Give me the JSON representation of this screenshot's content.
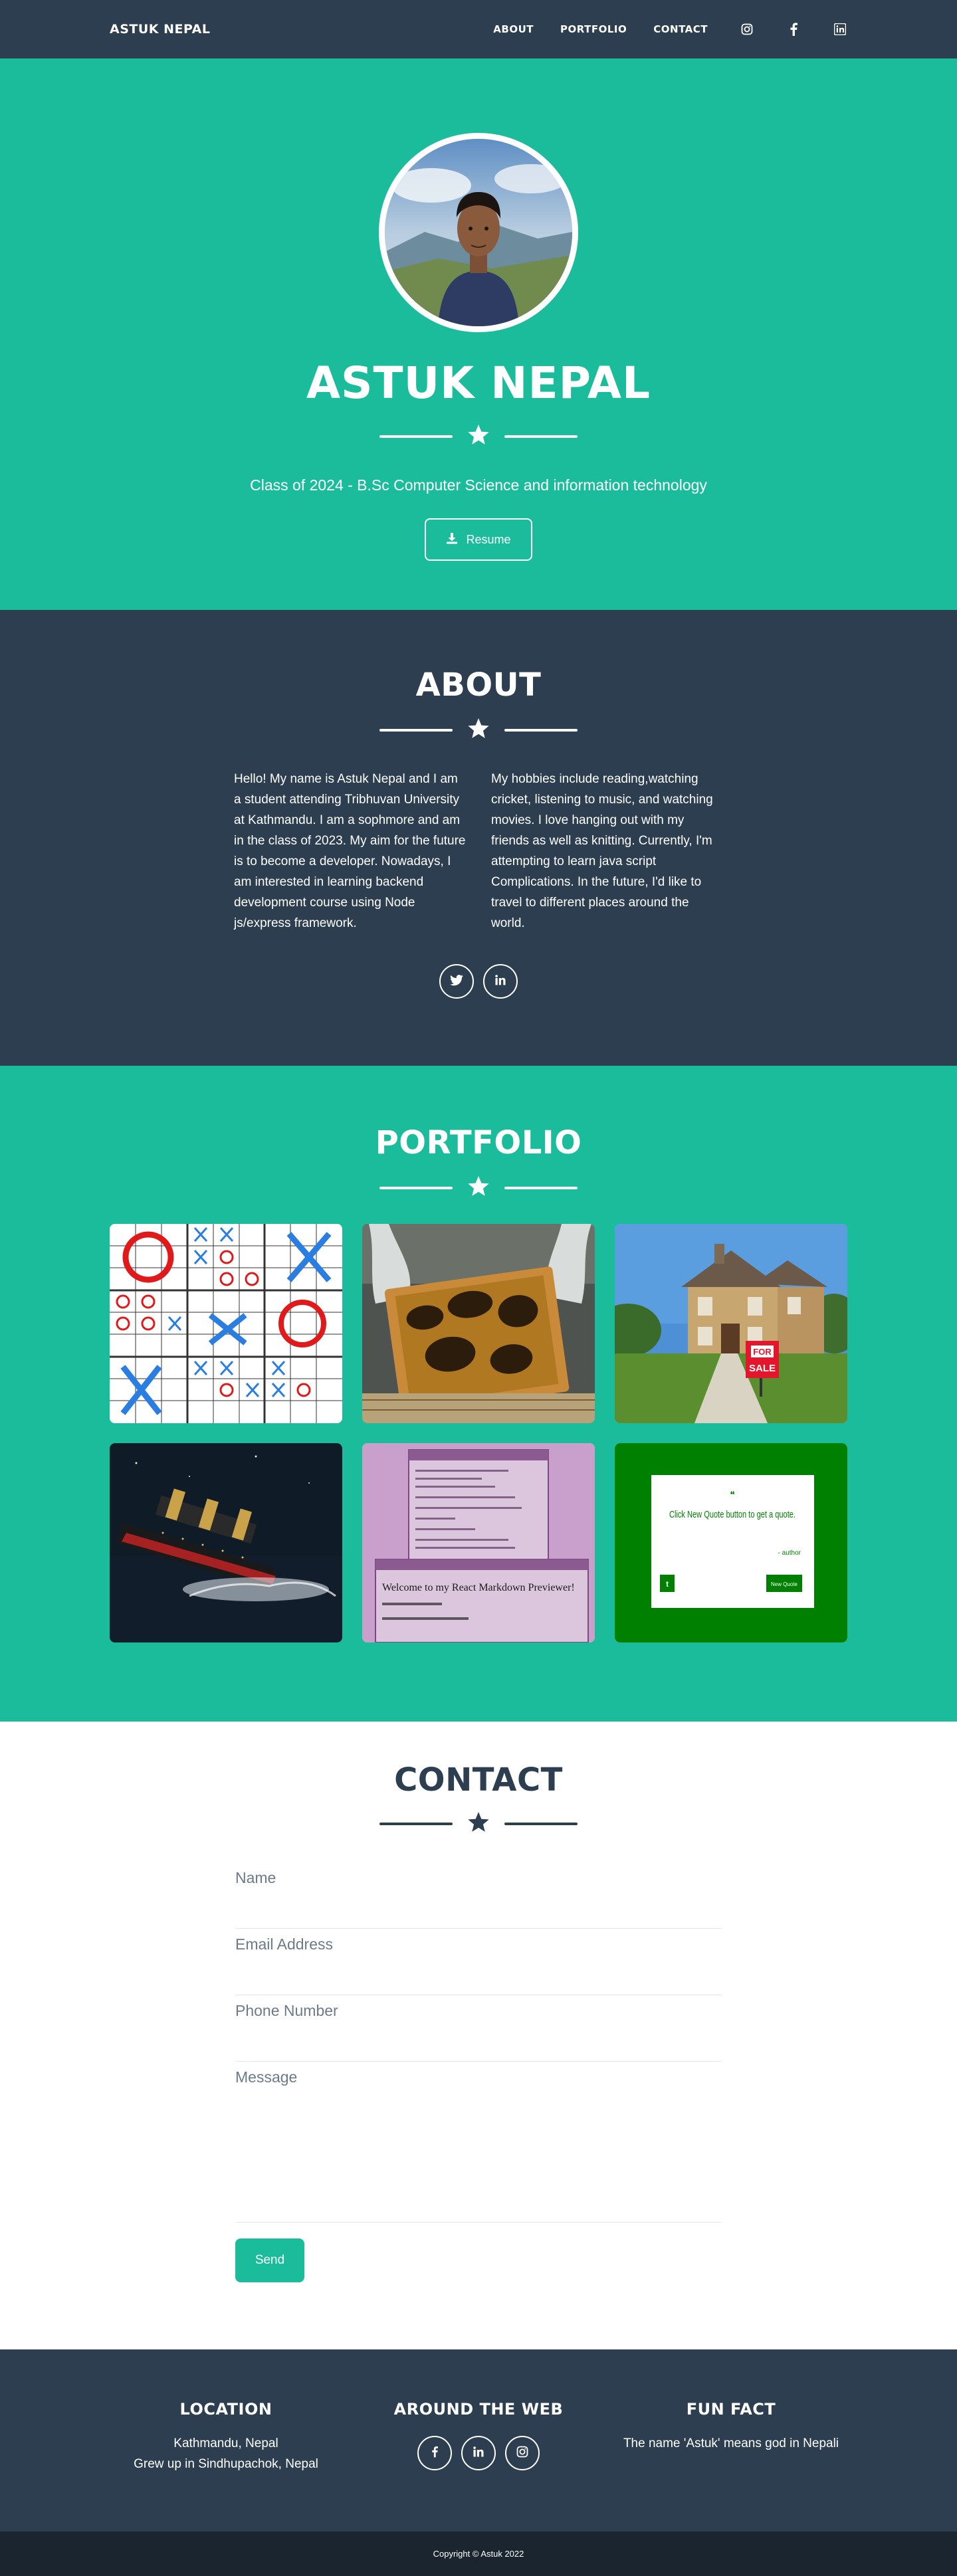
{
  "navbar": {
    "brand": "ASTUK NEPAL",
    "links": [
      "ABOUT",
      "PORTFOLIO",
      "CONTACT"
    ],
    "icons": [
      "instagram-icon",
      "facebook-icon",
      "linkedin-icon"
    ]
  },
  "hero": {
    "name": "ASTUK NEPAL",
    "subtitle": "Class of 2024 - B.Sc Computer Science and information technology",
    "resume_label": "Resume"
  },
  "about": {
    "title": "ABOUT",
    "col1": "Hello! My name is Astuk Nepal and I am a student attending Tribhuvan University at Kathmandu. I am a sophmore and am in the class of 2023. My aim for the future is to become a developer. Nowadays, I am interested in learning backend development course using Node js/express framework.",
    "col2": "My hobbies include reading,watching cricket, listening to music, and watching movies. I love hanging out with my friends as well as knitting. Currently, I'm attempting to learn java script Complications. In the future, I'd like to travel to different places around the world.",
    "icons": [
      "twitter-icon",
      "linkedin-icon"
    ]
  },
  "portfolio": {
    "title": "PORTFOLIO",
    "quote_text": "Click New Quote button to get a quote.",
    "quote_author": "- author",
    "quote_button": "New Quote",
    "for_sale_1": "FOR",
    "for_sale_2": "SALE",
    "md_title": "Welcome to my React Markdown Previewer!"
  },
  "contact": {
    "title": "CONTACT",
    "name_placeholder": "Name",
    "email_placeholder": "Email Address",
    "phone_placeholder": "Phone Number",
    "message_placeholder": "Message",
    "send_label": "Send"
  },
  "footer": {
    "location_heading": "LOCATION",
    "location_line1": "Kathmandu, Nepal",
    "location_line2": "Grew up in Sindhupachok, Nepal",
    "web_heading": "AROUND THE WEB",
    "fun_heading": "FUN FACT",
    "fun_text": "The name 'Astuk' means god in Nepali",
    "copyright": "Copyright © Astuk 2022"
  },
  "colors": {
    "primary": "#1abc9c",
    "secondary": "#2c3e50",
    "copyright_bg": "#1a252f"
  }
}
